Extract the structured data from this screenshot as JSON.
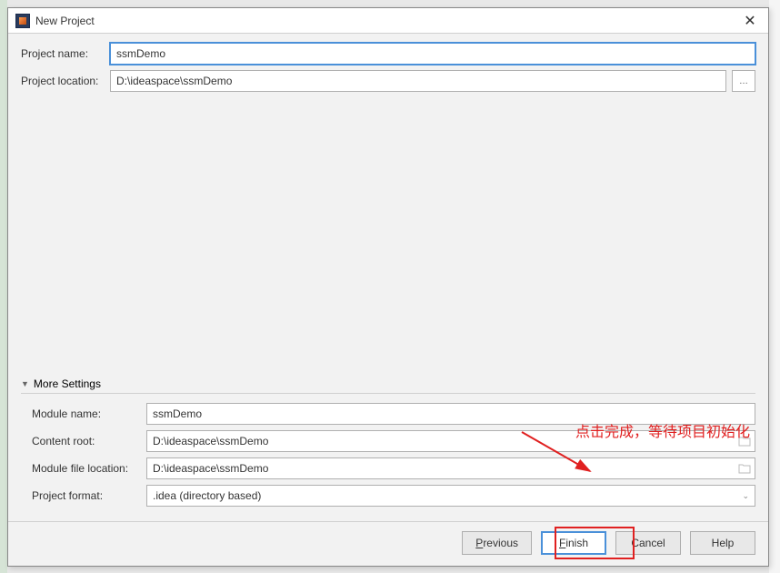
{
  "titlebar": {
    "title": "New Project"
  },
  "form": {
    "project_name_label": "Project name:",
    "project_name_value": "ssmDemo",
    "project_location_label": "Project location:",
    "project_location_value": "D:\\ideaspace\\ssmDemo"
  },
  "more": {
    "section_label": "More Settings",
    "module_name_label": "Module name:",
    "module_name_value": "ssmDemo",
    "content_root_label": "Content root:",
    "content_root_value": "D:\\ideaspace\\ssmDemo",
    "module_file_label": "Module file location:",
    "module_file_value": "D:\\ideaspace\\ssmDemo",
    "project_format_label": "Project format:",
    "project_format_value": ".idea (directory based)"
  },
  "buttons": {
    "previous": "Previous",
    "finish": "Finish",
    "cancel": "Cancel",
    "help": "Help"
  },
  "annotation": {
    "text": "点击完成，等待项目初始化"
  }
}
